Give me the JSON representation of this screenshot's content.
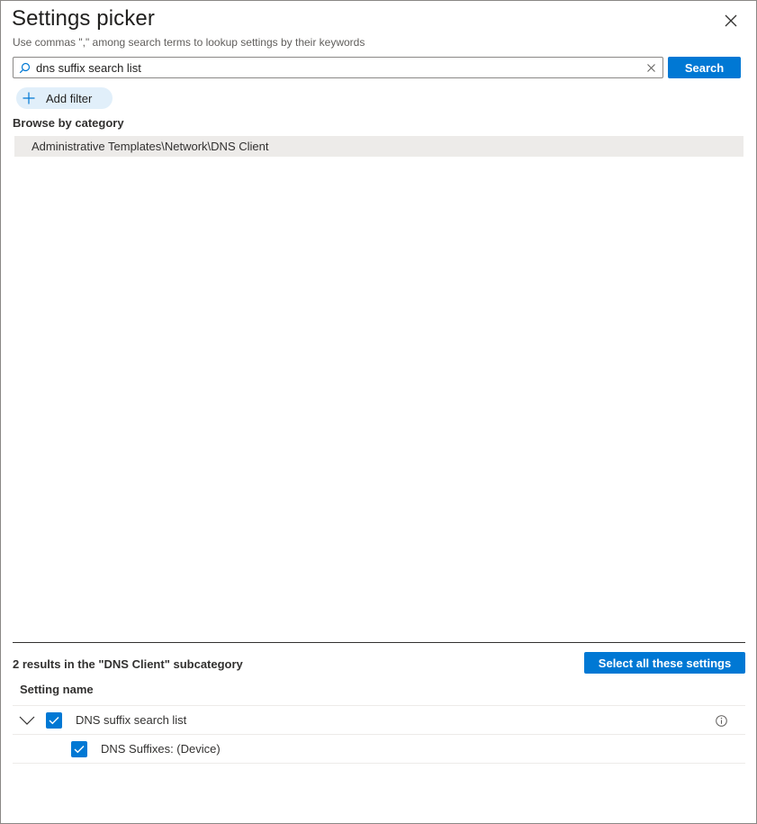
{
  "panel": {
    "title": "Settings picker",
    "subtitle": "Use commas \",\" among search terms to lookup settings by their keywords"
  },
  "search": {
    "value": "dns suffix search list",
    "placeholder": "",
    "button_label": "Search"
  },
  "filter": {
    "add_label": "Add filter"
  },
  "browse": {
    "label": "Browse by category",
    "categories": [
      "Administrative Templates\\Network\\DNS Client"
    ]
  },
  "results": {
    "summary": "2 results in the \"DNS Client\" subcategory",
    "select_all_label": "Select all these settings",
    "column_header": "Setting name",
    "rows": [
      {
        "label": "DNS suffix search list",
        "checked": true,
        "expanded": true
      },
      {
        "label": "DNS Suffixes: (Device)",
        "checked": true
      }
    ]
  },
  "icons": {
    "search": "search-icon",
    "clear": "clear-icon",
    "close": "close-icon",
    "plus": "plus-icon",
    "chevron": "chevron-down-icon",
    "check": "checkmark-icon",
    "info": "info-icon"
  },
  "colors": {
    "accent": "#0078d4",
    "filter_bg": "#e1effa",
    "selected_row": "#edebe9"
  }
}
